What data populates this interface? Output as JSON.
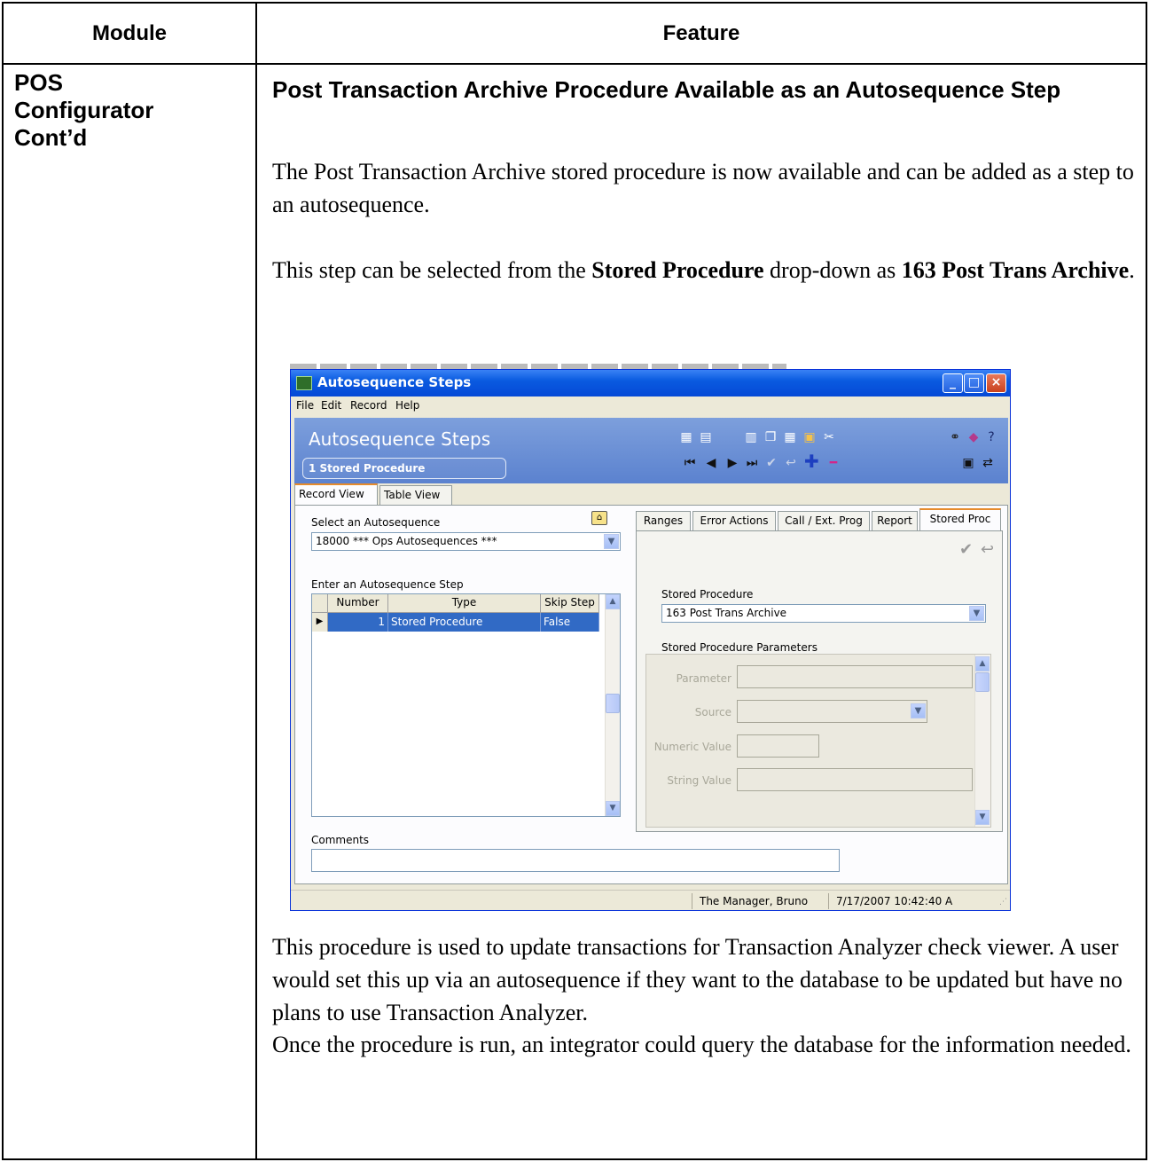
{
  "table": {
    "header_module": "Module",
    "header_feature": "Feature",
    "module_lines": [
      "POS",
      "Configurator",
      "Cont’d"
    ],
    "feature_title": "Post Transaction Archive Procedure Available as an Autosequence Step",
    "para1": "The Post Transaction Archive stored procedure is now available and can be added as a step to an autosequence.",
    "para2_pre": "This step can be selected from the ",
    "para2_bold1": "Stored Procedure",
    "para2_mid": " drop-down as ",
    "para2_bold2": "163 Post Trans Archive",
    "para2_post": ".",
    "para3": "This procedure is used to update transactions for Transaction Analyzer check viewer. A user would set this up via an autosequence if they want to the database to be updated but have no plans to use Transaction Analyzer.",
    "para4": "Once the procedure is run, an integrator could query the database for the information needed."
  },
  "window": {
    "title": "Autosequence Steps",
    "menu": [
      "File",
      "Edit",
      "Record",
      "Help"
    ],
    "banner_title": "Autosequence Steps",
    "banner_sub": "1  Stored Procedure",
    "view_tabs": [
      "Record View",
      "Table View"
    ],
    "select_label": "Select an Autosequence",
    "select_value": "18000  *** Ops Autosequences ***",
    "step_label": "Enter an Autosequence Step",
    "grid_headers": [
      "Number",
      "Type",
      "Skip Step"
    ],
    "grid_row": {
      "number": "1",
      "type": "Stored Procedure",
      "skip": "False"
    },
    "right_tabs": [
      "Ranges",
      "Error Actions",
      "Call / Ext. Prog",
      "Report",
      "Stored Proc"
    ],
    "sp_label": "Stored Procedure",
    "sp_value": "163  Post Trans Archive",
    "params_label": "Stored Procedure Parameters",
    "param_labels": [
      "Parameter",
      "Source",
      "Numeric Value",
      "String Value"
    ],
    "comments_label": "Comments",
    "status_user": "The Manager, Bruno",
    "status_time": "7/17/2007 10:42:40 A"
  },
  "icons": {
    "accent": "#0a5be0",
    "banner": "#6b8fd6",
    "toolbar_icons": [
      "find-icon",
      "clear-icon",
      "delete-icon",
      "copy-icon",
      "paste-icon",
      "print-icon",
      "binoculars-icon",
      "book-icon",
      "help-icon",
      "first-icon",
      "prev-icon",
      "next-icon",
      "last-icon",
      "save-icon",
      "undo-icon",
      "add-icon",
      "remove-icon",
      "monitor-icon",
      "network-icon"
    ]
  }
}
